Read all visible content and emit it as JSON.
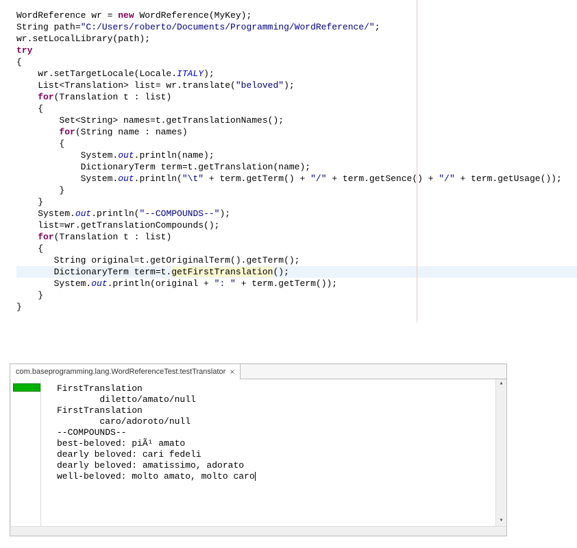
{
  "code": {
    "l1": {
      "a": "WordReference wr = ",
      "b": "new",
      "c": " WordReference(MyKey);"
    },
    "l2": {
      "a": "String path=",
      "b": "\"C:/Users/roberto/Documents/Programming/WordReference/\"",
      "c": ";"
    },
    "l3": "wr.setLocalLibrary(path);",
    "l4": "try",
    "l5": "{",
    "l6": {
      "a": "    wr.setTargetLocale(Locale.",
      "b": "ITALY",
      "c": ");"
    },
    "l7": {
      "a": "    List<Translation> list= wr.translate(",
      "b": "\"beloved\"",
      "c": ");"
    },
    "l8": "",
    "l9": {
      "a": "    ",
      "b": "for",
      "c": "(Translation t : list)"
    },
    "l10": "    {",
    "l11": "        Set<String> names=t.getTranslationNames();",
    "l12": "",
    "l13": {
      "a": "        ",
      "b": "for",
      "c": "(String name : names)"
    },
    "l14": "        {",
    "l15": {
      "a": "            System.",
      "b": "out",
      "c": ".println(name);"
    },
    "l16": "            DictionaryTerm term=t.getTranslation(name);",
    "l17": {
      "a": "            System.",
      "b": "out",
      "c": ".println(",
      "d": "\"\\t\"",
      "e": " + term.getTerm() + ",
      "f": "\"/\"",
      "g": " + term.getSence() + ",
      "h": "\"/\"",
      "i": " + term.getUsage());"
    },
    "l18": "        }",
    "l19": "    }",
    "l20": "",
    "l21": {
      "a": "    System.",
      "b": "out",
      "c": ".println(",
      "d": "\"--COMPOUNDS--\"",
      "e": ");"
    },
    "l22": "    list=wr.getTranslationCompounds();",
    "l23": {
      "a": "    ",
      "b": "for",
      "c": "(Translation t : list)"
    },
    "l24": "    {",
    "l25": "       String original=t.getOriginalTerm().getTerm();",
    "l26": {
      "a": "       DictionaryTerm term=t.",
      "b": "getFirstTranslation",
      "c": "();"
    },
    "l27": {
      "a": "       System.",
      "b": "out",
      "c": ".println(original + ",
      "d": "\": \"",
      "e": " + term.getTerm());"
    },
    "l28": "    }",
    "l29": "}"
  },
  "console": {
    "tabLabel": "com.baseprogramming.lang.WordReferenceTest.testTranslator",
    "output": "FirstTranslation\n        diletto/amato/null\nFirstTranslation\n        caro/adoroto/null\n--COMPOUNDS--\nbest-beloved: piÃ¹ amato\ndearly beloved: cari fedeli\ndearly beloved: amatissimo, adorato\nwell-beloved: molto amato, molto caro"
  }
}
